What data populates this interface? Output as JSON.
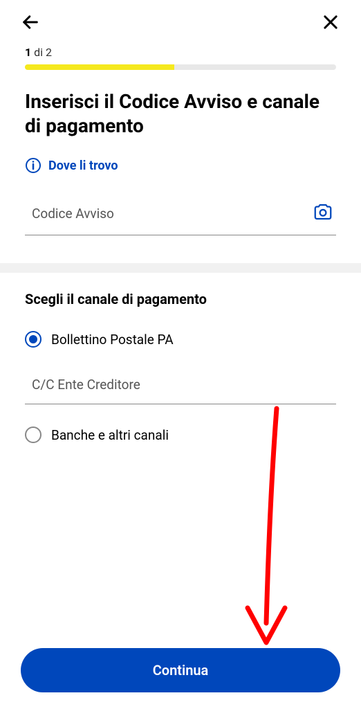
{
  "step": {
    "current": "1",
    "separator": " di ",
    "total": "2"
  },
  "title": "Inserisci il Codice Avviso e canale di pagamento",
  "helpLink": "Dove li trovo",
  "codiceAvviso": {
    "placeholder": "Codice Avviso"
  },
  "section": {
    "title": "Scegli il canale di pagamento",
    "options": [
      "Bollettino Postale PA",
      "Banche e altri canali"
    ],
    "ccPlaceholder": "C/C Ente Creditore"
  },
  "continueButton": "Continua"
}
